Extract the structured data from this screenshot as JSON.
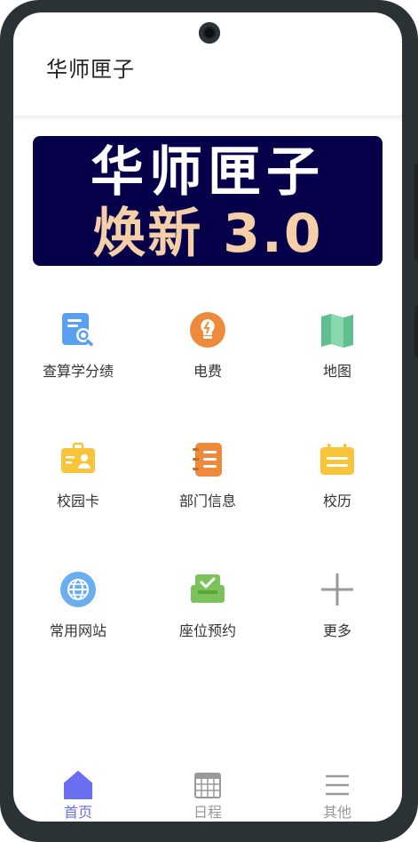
{
  "app": {
    "title": "华师匣子"
  },
  "banner": {
    "line1": "华师匣子",
    "line2": "焕新 3.0"
  },
  "grid": {
    "items": [
      {
        "label": "查算学分绩",
        "icon": "search-document-icon"
      },
      {
        "label": "电费",
        "icon": "lightbulb-icon"
      },
      {
        "label": "地图",
        "icon": "map-icon"
      },
      {
        "label": "校园卡",
        "icon": "id-card-icon"
      },
      {
        "label": "部门信息",
        "icon": "notebook-icon"
      },
      {
        "label": "校历",
        "icon": "calendar-icon"
      },
      {
        "label": "常用网站",
        "icon": "globe-icon"
      },
      {
        "label": "座位预约",
        "icon": "seat-icon"
      },
      {
        "label": "更多",
        "icon": "plus-icon"
      }
    ]
  },
  "tabbar": {
    "items": [
      {
        "label": "首页",
        "icon": "home-icon",
        "active": true
      },
      {
        "label": "日程",
        "icon": "schedule-icon",
        "active": false
      },
      {
        "label": "其他",
        "icon": "menu-icon",
        "active": false
      }
    ]
  },
  "colors": {
    "banner_bg": "#06004a",
    "banner_line1": "#ffffff",
    "banner_line2": "#f5cfa8",
    "active_tab": "#6b6ef0",
    "inactive_tab": "#999999"
  }
}
